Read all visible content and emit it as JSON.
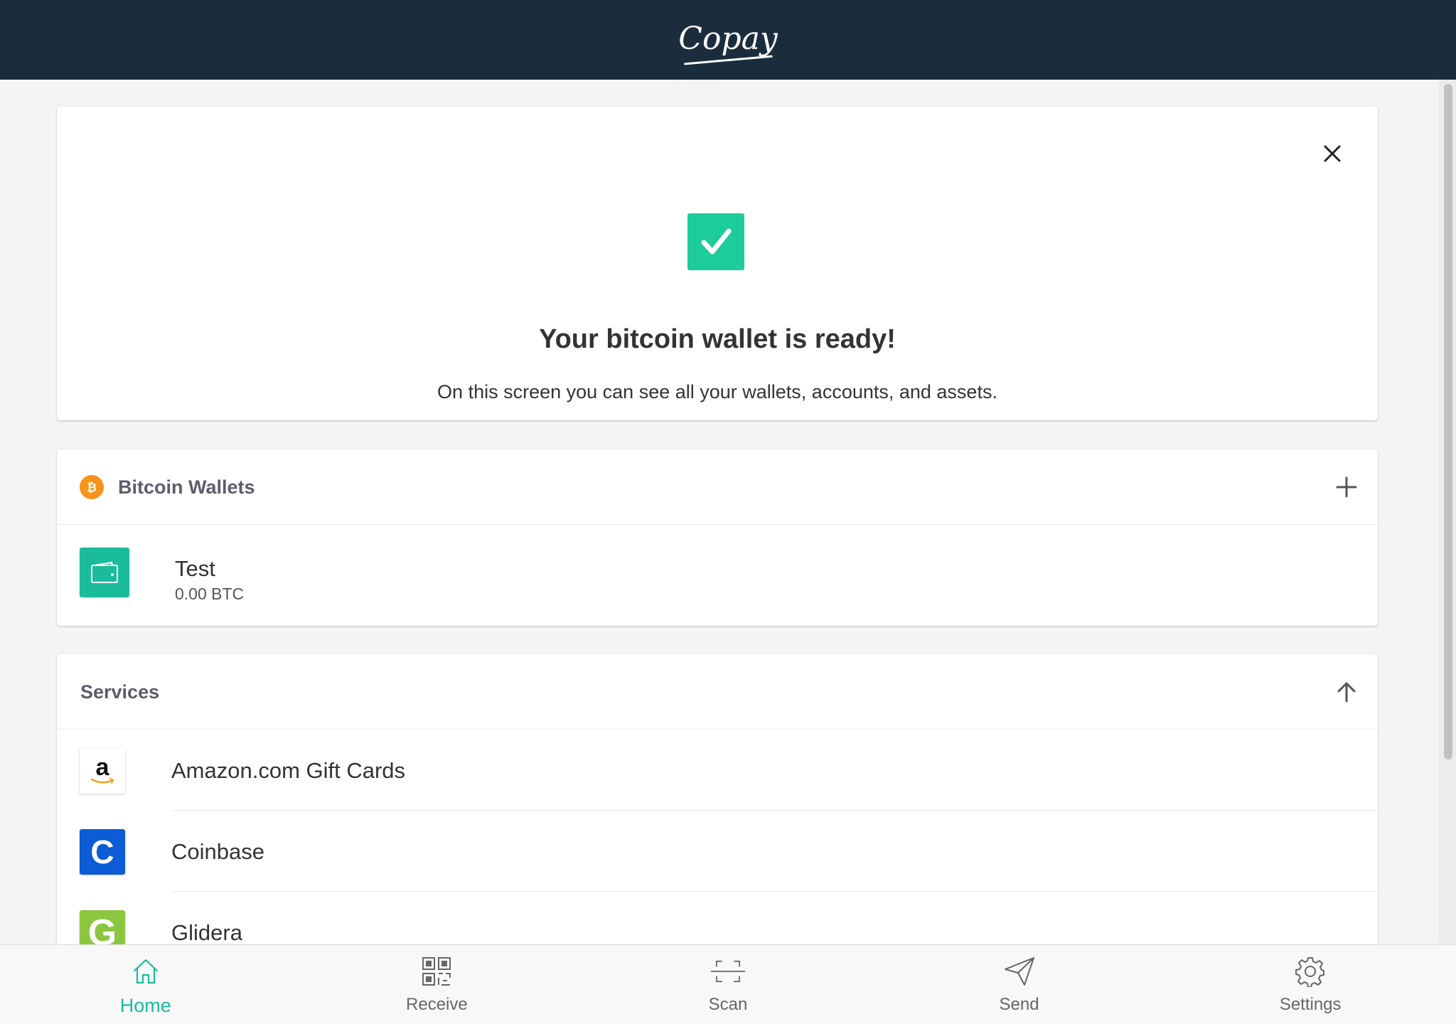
{
  "header": {
    "logo_text": "Copay"
  },
  "ready_card": {
    "title": "Your bitcoin wallet is ready!",
    "subtitle": "On this screen you can see all your wallets, accounts, and assets."
  },
  "wallets": {
    "section_title": "Bitcoin Wallets",
    "items": [
      {
        "name": "Test",
        "balance": "0.00 BTC"
      }
    ]
  },
  "services": {
    "section_title": "Services",
    "items": [
      {
        "name": "Amazon.com Gift Cards",
        "icon_letter": "a"
      },
      {
        "name": "Coinbase",
        "icon_letter": "C"
      },
      {
        "name": "Glidera",
        "icon_letter": "G"
      }
    ]
  },
  "tabs": [
    {
      "label": "Home",
      "icon": "home-icon",
      "active": true
    },
    {
      "label": "Receive",
      "icon": "qr-code-icon",
      "active": false
    },
    {
      "label": "Scan",
      "icon": "scan-icon",
      "active": false
    },
    {
      "label": "Send",
      "icon": "paper-plane-icon",
      "active": false
    },
    {
      "label": "Settings",
      "icon": "gear-icon",
      "active": false
    }
  ],
  "colors": {
    "header_bg": "#1b2d3d",
    "accent": "#1abc9c",
    "check_green": "#1ccc9a",
    "bitcoin_orange": "#f7931a",
    "coinbase_blue": "#0b5cd5",
    "glidera_green": "#8cc63f"
  }
}
